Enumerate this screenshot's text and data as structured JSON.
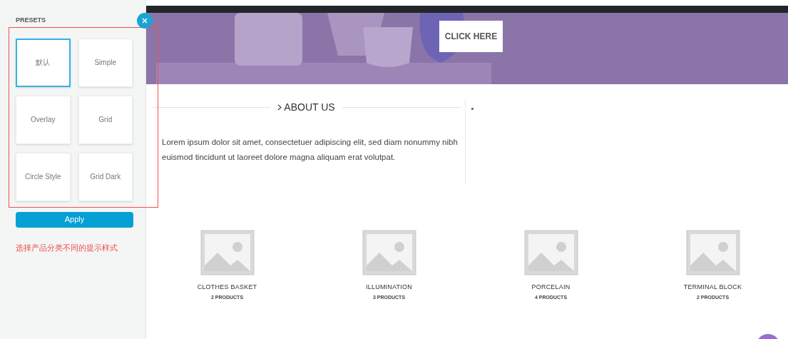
{
  "presets": {
    "title": "PRESETS",
    "items": [
      {
        "label": "默认",
        "selected": true
      },
      {
        "label": "Simple",
        "selected": false
      },
      {
        "label": "Overlay",
        "selected": false
      },
      {
        "label": "Grid",
        "selected": false
      },
      {
        "label": "Circle Style",
        "selected": false
      },
      {
        "label": "Grid Dark",
        "selected": false
      }
    ],
    "apply": "Apply",
    "note": "选择产品分类不同的提示样式"
  },
  "banner": {
    "button": "CLICK HERE"
  },
  "about": {
    "heading": "ABOUT US",
    "text": "Lorem ipsum dolor sit amet, consectetuer adipiscing elit, sed diam nonummy nibh euismod tincidunt ut laoreet dolore magna aliquam erat volutpat."
  },
  "categories": [
    {
      "name": "CLOTHES BASKET",
      "count": "2 PRODUCTS"
    },
    {
      "name": "ILLUMINATION",
      "count": "3 PRODUCTS"
    },
    {
      "name": "PORCELAIN",
      "count": "4 PRODUCTS"
    },
    {
      "name": "TERMINAL BLOCK",
      "count": "2 PRODUCTS"
    }
  ]
}
